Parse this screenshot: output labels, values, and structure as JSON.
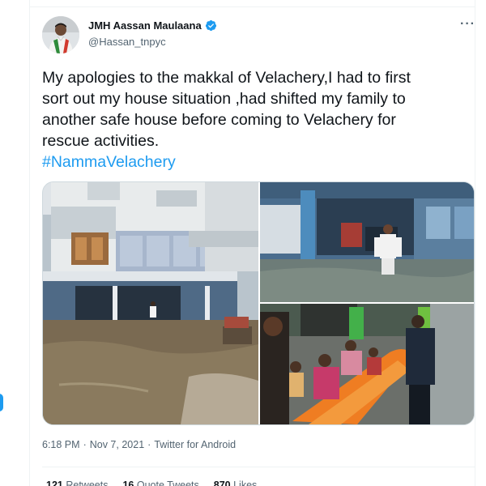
{
  "tweet": {
    "display_name": "JMH Aassan Maulaana",
    "handle": "@Hassan_tnpyc",
    "text_lines": [
      "My apologies to the makkal of Velachery,I had to first",
      "sort out my house situation ,had shifted my family to",
      "another safe house before coming to Velachery for",
      "rescue activities."
    ],
    "hashtag": "#NammaVelachery",
    "time": "6:18 PM",
    "separator": "·",
    "date": "Nov 7, 2021",
    "source": "Twitter for Android",
    "stats": {
      "retweets_count": "121",
      "retweets_label": "Retweets",
      "quotes_count": "16",
      "quotes_label": "Quote Tweets",
      "likes_count": "870",
      "likes_label": "Likes"
    }
  },
  "colors": {
    "accent": "#1d9bf0",
    "text_primary": "#0f1419",
    "text_secondary": "#536471",
    "border": "#cfd9de"
  },
  "icons": {
    "verified": "verified-badge-icon",
    "more": "more-options-icon"
  }
}
